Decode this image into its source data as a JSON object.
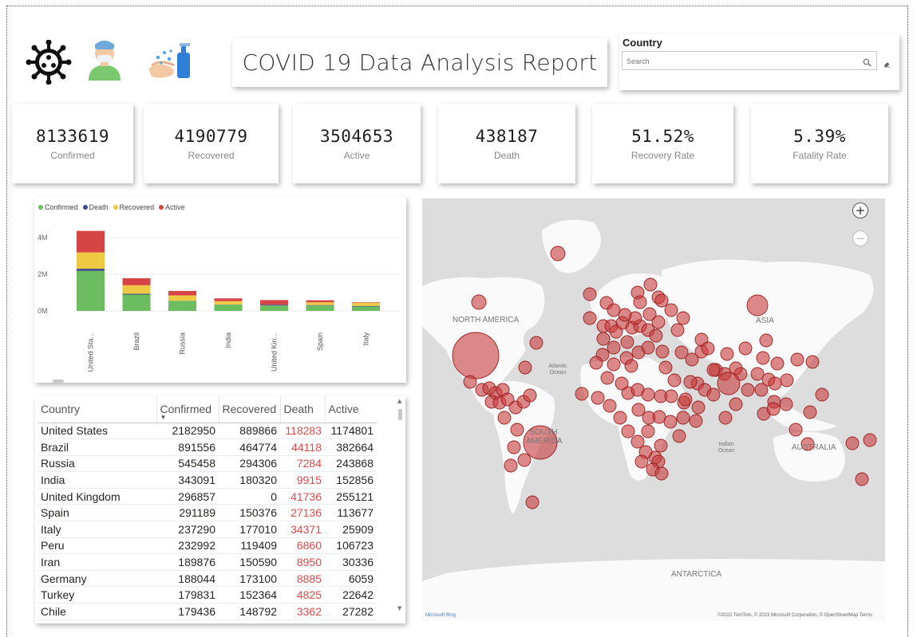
{
  "report": {
    "title": "COVID 19 Data Analysis Report",
    "icons": [
      "virus-icon",
      "masked-person-icon",
      "hand-sanitizer-icon"
    ]
  },
  "slicer": {
    "label": "Country",
    "placeholder": "Search"
  },
  "kpis": [
    {
      "value": "8133619",
      "caption": "Confirmed"
    },
    {
      "value": "4190779",
      "caption": "Recovered"
    },
    {
      "value": "3504653",
      "caption": "Active"
    },
    {
      "value": "438187",
      "caption": "Death"
    },
    {
      "value": "51.52%",
      "caption": "Recovery Rate"
    },
    {
      "value": "5.39%",
      "caption": "Fatality Rate"
    }
  ],
  "colors": {
    "confirmed": "#6BBD5F",
    "death": "#3B4A8C",
    "recovered": "#EDC944",
    "active": "#D64545",
    "death_text": "#E04848",
    "bubble": "#C83C3C"
  },
  "chart_data": {
    "type": "bar",
    "stacked": true,
    "categories": [
      "United Sta...",
      "Brazil",
      "Russia",
      "India",
      "United Kin...",
      "Spain",
      "Italy"
    ],
    "series": [
      {
        "name": "Confirmed",
        "values": [
          2182950,
          891556,
          545458,
          343091,
          296857,
          291189,
          237290
        ]
      },
      {
        "name": "Death",
        "values": [
          118283,
          44118,
          7284,
          9915,
          41736,
          27136,
          34371
        ]
      },
      {
        "name": "Recovered",
        "values": [
          889866,
          464774,
          294306,
          180320,
          0,
          150376,
          177010
        ]
      },
      {
        "name": "Active",
        "values": [
          1174801,
          382664,
          243868,
          152856,
          255121,
          113677,
          25909
        ]
      }
    ],
    "y_ticks": [
      "0M",
      "2M",
      "4M"
    ],
    "ylim": [
      0,
      4500000
    ],
    "legend": "top-left",
    "grid": true
  },
  "table": {
    "columns": [
      "Country",
      "Confirmed",
      "Recovered",
      "Death",
      "Active"
    ],
    "rows": [
      [
        "United States",
        "2182950",
        "889866",
        "118283",
        "1174801"
      ],
      [
        "Brazil",
        "891556",
        "464774",
        "44118",
        "382664"
      ],
      [
        "Russia",
        "545458",
        "294306",
        "7284",
        "243868"
      ],
      [
        "India",
        "343091",
        "180320",
        "9915",
        "152856"
      ],
      [
        "United Kingdom",
        "296857",
        "0",
        "41736",
        "255121"
      ],
      [
        "Spain",
        "291189",
        "150376",
        "27136",
        "113677"
      ],
      [
        "Italy",
        "237290",
        "177010",
        "34371",
        "25909"
      ],
      [
        "Peru",
        "232992",
        "119409",
        "6860",
        "106723"
      ],
      [
        "Iran",
        "189876",
        "150590",
        "8950",
        "30336"
      ],
      [
        "Germany",
        "188044",
        "173100",
        "8885",
        "6059"
      ],
      [
        "Turkey",
        "179831",
        "152364",
        "4825",
        "22642"
      ],
      [
        "Chile",
        "179436",
        "148792",
        "3362",
        "27282"
      ]
    ]
  },
  "map": {
    "labels": {
      "north_america": "NORTH AMERICA",
      "south_america": "SOUTH AMERICA",
      "asia": "ASIA",
      "australia": "AUSTRALIA",
      "antarctica": "ANTARCTICA",
      "atlantic": "Atlantic Ocean",
      "indian": "Indian Ocean"
    },
    "zoom_in": "+",
    "zoom_out": "−",
    "brand": "Microsoft Bing",
    "attribution": "©2022 TomTom, © 2023 Microsoft Corporation, © OpenStreetMap Terms"
  }
}
